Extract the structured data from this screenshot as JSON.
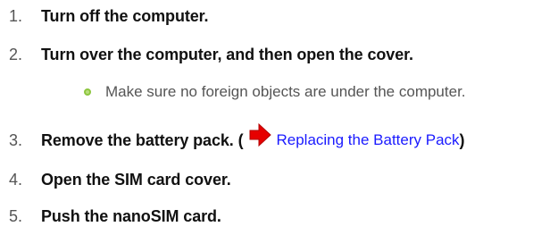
{
  "steps": [
    {
      "num": "1.",
      "text": "Turn off the computer."
    },
    {
      "num": "2.",
      "text": "Turn over the computer, and then open the cover."
    },
    {
      "num": "3.",
      "text": "Remove the battery pack. (",
      "link": "Replacing the Battery Pack",
      "close": ")"
    },
    {
      "num": "4.",
      "text": "Open the SIM card cover."
    },
    {
      "num": "5.",
      "text": "Push the nanoSIM card."
    }
  ],
  "bullet": {
    "text": "Make sure no foreign objects are under the computer.",
    "color": "#8dc63f"
  },
  "icons": {
    "reference_arrow": "red-right-arrow-icon",
    "bullet": "green-circle-bullet-icon"
  },
  "colors": {
    "link": "#1a1aff",
    "arrow": "#e60000"
  }
}
